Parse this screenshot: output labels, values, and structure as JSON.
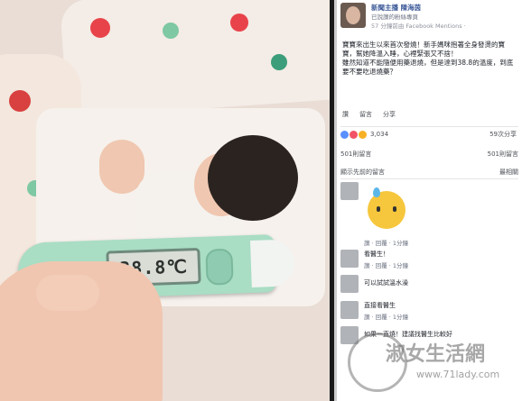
{
  "post": {
    "author": "新聞主播 陳海茵",
    "subtitle": "已說讚的粉絲專頁",
    "time": "57 分鐘前由 Facebook Mentions ·",
    "text": "寶寶來出生以來首次發燒！新手媽咪抱著全身發燙的寶寶，幫她降溫入睡，心裡緊張又不捨！\n雖然知道不能隨便用藥退燒，但是達到38.8的溫度，到底要不要吃退燒藥？",
    "actions": [
      "讚",
      "留言",
      "分享"
    ],
    "reactions_count": "3,034",
    "shares": "59次分享",
    "comments_count": "501則留言",
    "comments_more": "501則留言",
    "relevant_label": "顯示先前的留言",
    "relevant_right": "最相關",
    "reaction_colors": [
      "#5890ff",
      "#f25268",
      "#f7b125"
    ]
  },
  "thermometer": {
    "reading": "38.8℃"
  },
  "comments": [
    {
      "text": "",
      "meta": "讚 · 回覆 · 1分鐘"
    },
    {
      "text": "看醫生！",
      "meta": "讚 · 回覆 · 1分鐘"
    },
    {
      "text": "可以試試溫水澡",
      "meta": ""
    },
    {
      "text": "直接看醫生",
      "meta": "讚 · 回覆 · 1分鐘"
    },
    {
      "text": "如果一直燒！建議找醫生比較好",
      "meta": ""
    }
  ],
  "watermark": {
    "site": "www.71lady.com",
    "name": "淑女生活網"
  }
}
